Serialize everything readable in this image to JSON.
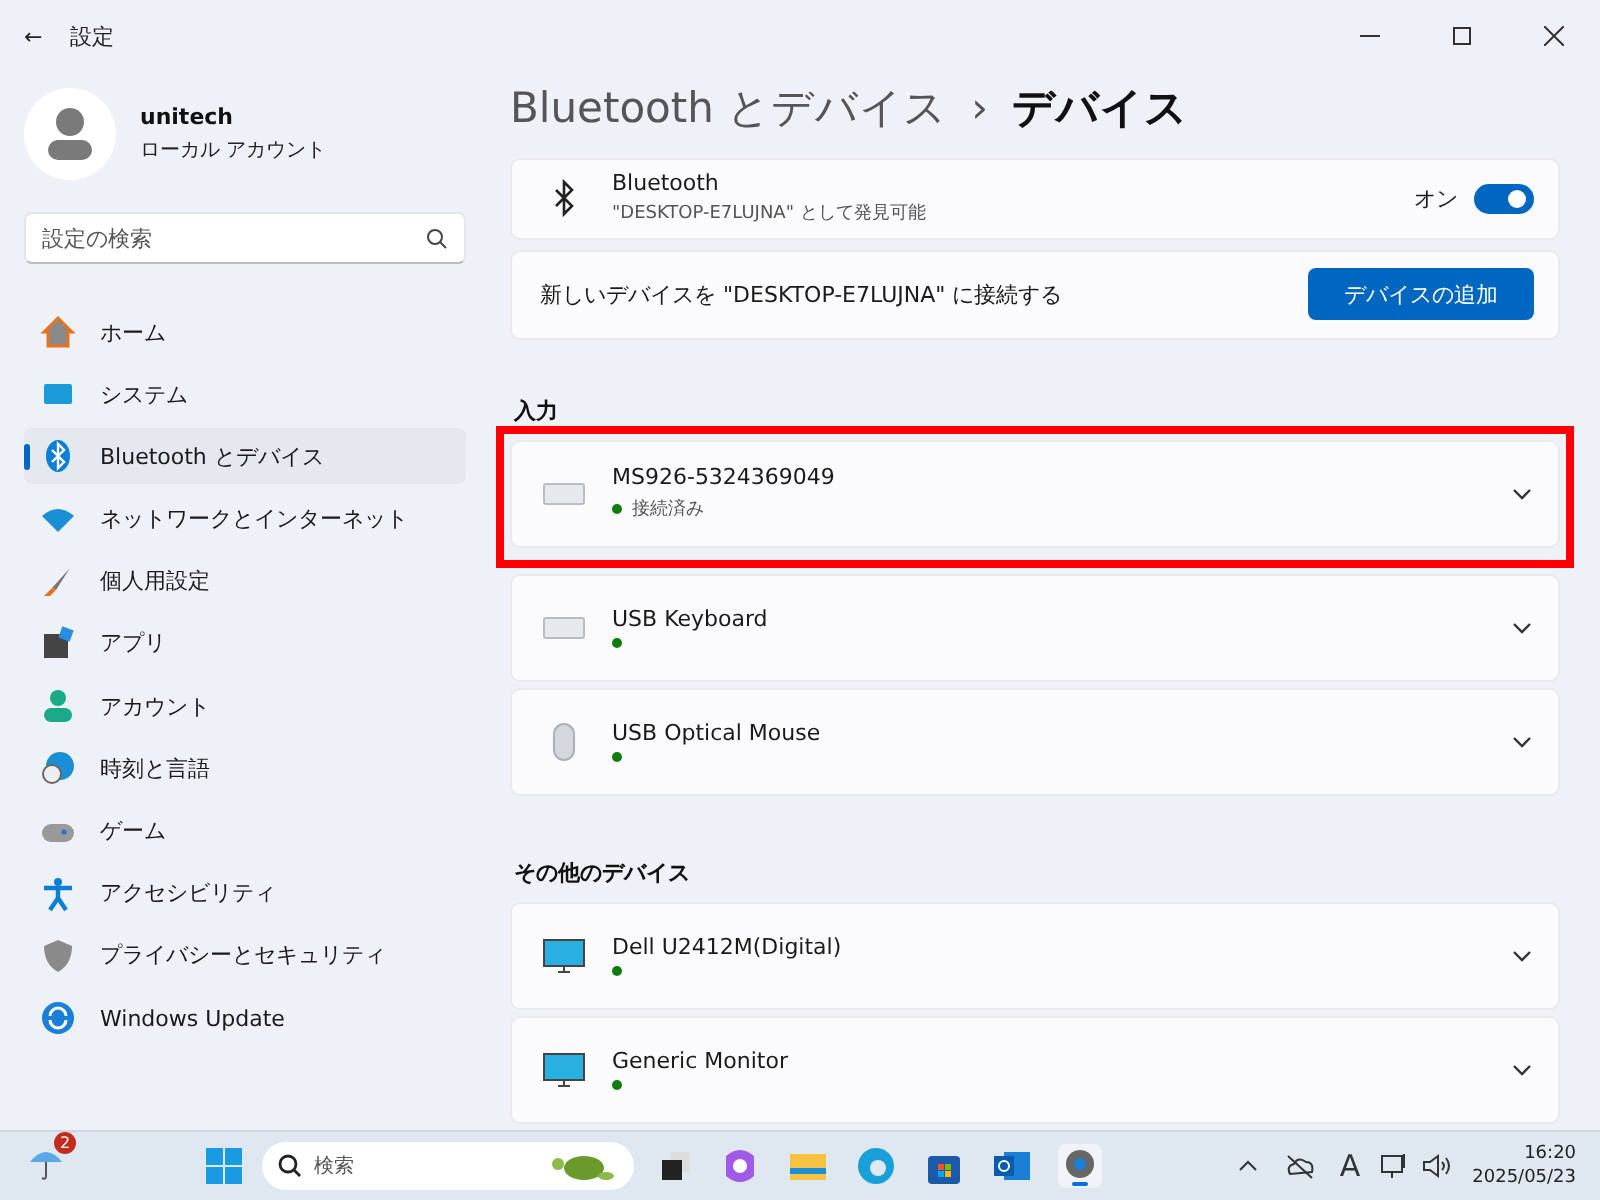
{
  "window": {
    "back": "←",
    "title": "設定"
  },
  "account": {
    "name": "unitech",
    "type": "ローカル アカウント"
  },
  "search": {
    "placeholder": "設定の検索"
  },
  "nav": [
    {
      "label": "ホーム",
      "selected": false
    },
    {
      "label": "システム",
      "selected": false
    },
    {
      "label": "Bluetooth とデバイス",
      "selected": true
    },
    {
      "label": "ネットワークとインターネット",
      "selected": false
    },
    {
      "label": "個人用設定",
      "selected": false
    },
    {
      "label": "アプリ",
      "selected": false
    },
    {
      "label": "アカウント",
      "selected": false
    },
    {
      "label": "時刻と言語",
      "selected": false
    },
    {
      "label": "ゲーム",
      "selected": false
    },
    {
      "label": "アクセシビリティ",
      "selected": false
    },
    {
      "label": "プライバシーとセキュリティ",
      "selected": false
    },
    {
      "label": "Windows Update",
      "selected": false
    }
  ],
  "breadcrumb": {
    "parent": "Bluetooth とデバイス",
    "separator": "›",
    "current": "デバイス"
  },
  "bluetooth": {
    "title": "Bluetooth",
    "subtitle": "\"DESKTOP-E7LUJNA\" として発見可能",
    "state_label": "オン",
    "on": true
  },
  "add_device": {
    "text": "新しいデバイスを \"DESKTOP-E7LUJNA\" に接続する",
    "button": "デバイスの追加"
  },
  "sections": [
    {
      "title": "入力",
      "devices": [
        {
          "name": "MS926-5324369049",
          "status": "接続済み",
          "kind": "keyboard",
          "color": "#107c10",
          "highlighted": true
        },
        {
          "name": "USB Keyboard",
          "kind": "keyboard",
          "color": "#107c10",
          "highlighted": false
        },
        {
          "name": "USB Optical Mouse",
          "kind": "mouse",
          "color": "#107c10",
          "highlighted": false
        }
      ]
    },
    {
      "title": "その他のデバイス",
      "devices": [
        {
          "name": "Dell U2412M(Digital)",
          "kind": "monitor",
          "color": "#107c10",
          "highlighted": false
        },
        {
          "name": "Generic Monitor",
          "kind": "monitor",
          "color": "#107c10",
          "highlighted": false
        }
      ]
    }
  ],
  "taskbar": {
    "weather_badge": "2",
    "search_placeholder": "検索",
    "ime": "A",
    "time": "16:20",
    "date": "2025/05/23"
  }
}
